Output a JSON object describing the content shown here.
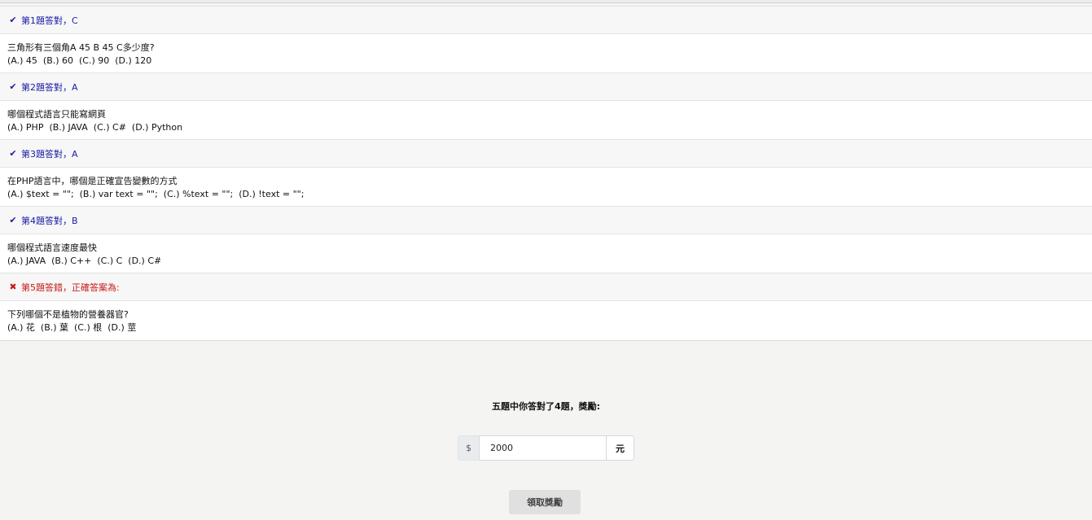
{
  "questions": [
    {
      "status": "correct",
      "mark_icon": "check-icon",
      "mark": "✔",
      "result": "第1題答對，C",
      "question": "三角形有三個角A 45 B 45 C多少度?",
      "options": "(A.) 45  (B.) 60  (C.) 90  (D.) 120"
    },
    {
      "status": "correct",
      "mark_icon": "check-icon",
      "mark": "✔",
      "result": "第2題答對，A",
      "question": "哪個程式語言只能寫網頁",
      "options": "(A.) PHP  (B.) JAVA  (C.) C#  (D.) Python"
    },
    {
      "status": "correct",
      "mark_icon": "check-icon",
      "mark": "✔",
      "result": "第3題答對，A",
      "question": "在PHP語言中，哪個是正確宣告變數的方式",
      "options": "(A.) $text = \"\";  (B.) var text = \"\";  (C.) %text = \"\";  (D.) !text = \"\";"
    },
    {
      "status": "correct",
      "mark_icon": "check-icon",
      "mark": "✔",
      "result": "第4題答對，B",
      "question": "哪個程式語言速度最快",
      "options": "(A.) JAVA  (B.) C++  (C.) C  (D.) C#"
    },
    {
      "status": "wrong",
      "mark_icon": "cross-icon",
      "mark": "✖",
      "result": "第5題答錯，正確答案為:",
      "question": "下列哪個不是植物的營養器官?",
      "options": "(A.) 花  (B.) 葉  (C.) 根  (D.) 莖"
    }
  ],
  "reward": {
    "title": "五題中你答對了4題，獎勵:",
    "currency_prefix": "$",
    "amount": "2000",
    "unit": "元",
    "claim_label": "領取獎勵"
  },
  "colors": {
    "correct": "#1a1aa6",
    "wrong": "#c81919"
  }
}
